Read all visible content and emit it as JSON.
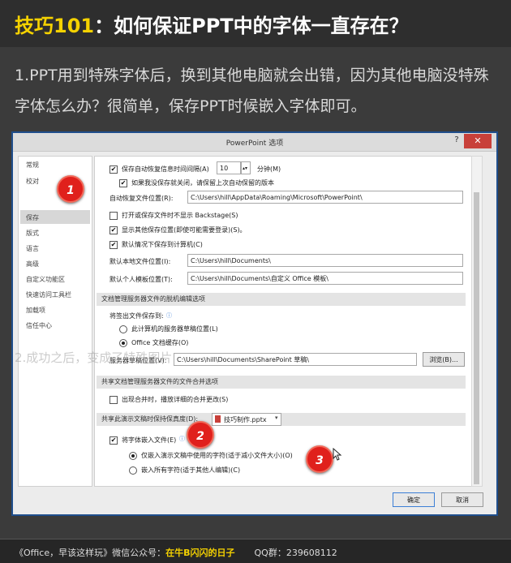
{
  "header": {
    "title_prefix": "技巧101",
    "title_rest": "：如何保证PPT中的字体一直存在？"
  },
  "intro": "1.PPT用到特殊字体后，换到其他电脑就会出错，因为其他电脑没特殊字体怎么办？很简单，保存PPT时候嵌入字体即可。",
  "dialog": {
    "title": "PowerPoint 选项",
    "help": "?",
    "close": "✕",
    "nav": [
      "常规",
      "校对",
      "保存",
      "版式",
      "语言",
      "高级",
      "自定义功能区",
      "快速访问工具栏",
      "加载项",
      "信任中心"
    ],
    "save": {
      "autosave_label": "保存自动恢复信息时间间隔(A)",
      "autosave_value": "10",
      "minutes": "分钟(M)",
      "keep_last_label": "如果我没保存就关闭，请保留上次自动保留的版本",
      "recover_location_label": "自动恢复文件位置(R):",
      "recover_location_value": "C:\\Users\\hill\\AppData\\Roaming\\Microsoft\\PowerPoint\\",
      "no_backstage_label": "打开或保存文件时不显示 Backstage(S)",
      "show_other_label": "显示其他保存位置(即使可能需要登录)(S)。",
      "default_computer_label": "默认情况下保存到计算机(C)",
      "local_location_label": "默认本地文件位置(I):",
      "local_location_value": "C:\\Users\\hill\\Documents\\",
      "template_location_label": "默认个人模板位置(T):",
      "template_location_value": "C:\\Users\\hill\\Documents\\自定义 Office 模板\\"
    },
    "offline": {
      "section": "文档管理服务器文件的脱机编辑选项",
      "checkout_label": "将签出文件保存到:",
      "option_server": "此计算机的服务器草稿位置(L)",
      "option_cache": "Office 文档缓存(O)",
      "drafts_label": "服务器草稿位置(V):",
      "drafts_value": "C:\\Users\\hill\\Documents\\SharePoint 草稿\\",
      "browse": "浏览(B)..."
    },
    "merge": {
      "section": "共享文档管理服务器文件的文件合并选项",
      "show_changes_label": "出现合并时，播放详细的合并更改(S)"
    },
    "fidelity": {
      "section": "共享此演示文稿时保持保真度(D):",
      "file": "技巧制作.pptx",
      "embed_label": "将字体嵌入文件(E)",
      "embed_used": "仅嵌入演示文稿中使用的字符(适于减小文件大小)(O)",
      "embed_all": "嵌入所有字符(适于其他人编辑)(C)"
    },
    "ok": "确定",
    "cancel": "取消"
  },
  "callouts": [
    "1",
    "2",
    "3"
  ],
  "watermark": "2.成功之后，变成了特殊图片",
  "footer": {
    "prefix": "《Office，早该这样玩》微信公众号：",
    "account": "在牛B闪闪的日子",
    "qq": "QQ群：239608112"
  },
  "colors": {
    "accent": "#f5d200",
    "callout": "#e0201c",
    "background": "#3b3b3b"
  }
}
